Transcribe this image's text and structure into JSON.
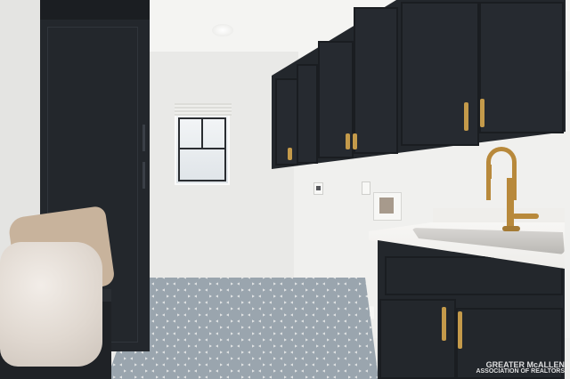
{
  "photo": {
    "subject": "laundry-room",
    "colors": {
      "cabinet": "#23272c",
      "hardware_gold": "#c49a4a",
      "wall": "#ededeb",
      "floor_tile_pattern": "#9aa5ae",
      "pillow_tan": "#c8b39c"
    }
  },
  "watermark": {
    "line1": "GREATER McALLEN",
    "line2": "ASSOCIATION OF REALTORS"
  }
}
